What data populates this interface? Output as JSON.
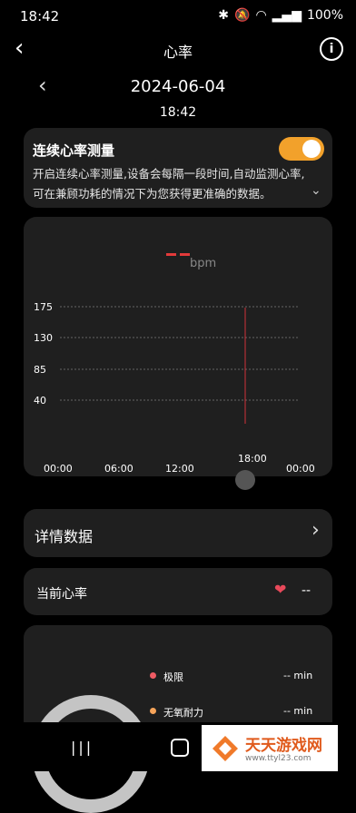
{
  "status_bar": {
    "time": "18:42",
    "battery": "100%"
  },
  "header": {
    "title": "心率"
  },
  "date": "2024-06-04",
  "time": "18:42",
  "continuous": {
    "title": "连续心率测量",
    "desc": "开启连续心率测量,设备会每隔一段时间,自动监测心率,可在兼顾功耗的情况下为您获得更准确的数据。",
    "enabled": true
  },
  "chart": {
    "bpm_value": "--",
    "unit": "bpm",
    "y_ticks": [
      "175",
      "130",
      "85",
      "40"
    ],
    "x_ticks": [
      "00:00",
      "06:00",
      "12:00",
      "18:00",
      "00:00"
    ],
    "cursor_label": "18:00"
  },
  "chart_data": {
    "type": "line",
    "title": "",
    "xlabel": "",
    "ylabel": "",
    "y_ticks": [
      175,
      130,
      85,
      40
    ],
    "x_ticks": [
      "00:00",
      "06:00",
      "12:00",
      "18:00",
      "00:00"
    ],
    "series": [
      {
        "values": []
      }
    ]
  },
  "detail": {
    "label": "详情数据"
  },
  "current_hr": {
    "label": "当前心率",
    "value": "--"
  },
  "zones": [
    {
      "label": "极限",
      "value": "-- min",
      "color": "#ef5b64"
    },
    {
      "label": "无氧耐力",
      "value": "-- min",
      "color": "#f7a45a"
    }
  ],
  "watermark": {
    "brand": "天天游戏网",
    "url": "www.ttyl23.com"
  }
}
